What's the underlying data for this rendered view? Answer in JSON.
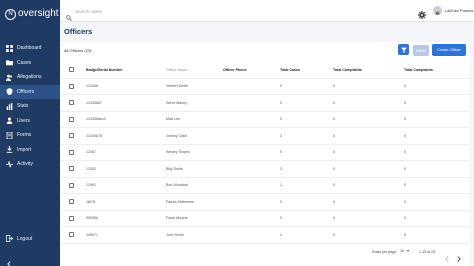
{
  "app": {
    "logo_text": "oversight",
    "logo_sub": "· · · · ·",
    "logo_icon": "N"
  },
  "sidebar": {
    "items": [
      {
        "label": "Dashboard",
        "icon": "grid-icon"
      },
      {
        "label": "Cases",
        "icon": "folder-icon"
      },
      {
        "label": "Allegations",
        "icon": "people-icon"
      },
      {
        "label": "Officers",
        "icon": "badge-icon",
        "active": true
      },
      {
        "label": "Stats",
        "icon": "bar-chart-icon"
      },
      {
        "label": "Users",
        "icon": "users-icon"
      },
      {
        "label": "Forms",
        "icon": "forms-icon"
      },
      {
        "label": "Import",
        "icon": "import-icon"
      },
      {
        "label": "Activity",
        "icon": "activity-icon"
      }
    ],
    "logout_label": "Logout"
  },
  "topbar": {
    "search_placeholder": "Search cases",
    "user_name": "LaDuke Powers"
  },
  "page": {
    "title": "Officers",
    "all_count": "All Officers (23)"
  },
  "actions": {
    "delete_label": "Delete",
    "create_label": "Create Officer"
  },
  "table": {
    "columns": [
      "Badge/Serial Number",
      "Officer Name",
      "Officer Phone",
      "Total Cases",
      "Total Complaints",
      "Total Complaints"
    ],
    "rows": [
      [
        "123456",
        "Jameer Smith",
        "",
        "0",
        "0",
        "0"
      ],
      [
        "12345667",
        "Steve Macey",
        "",
        "0",
        "0",
        "0"
      ],
      [
        "123456abc2",
        "Matt Lee",
        "",
        "0",
        "0",
        "0"
      ],
      [
        "12345678",
        "Johnny Cash",
        "",
        "3",
        "0",
        "0"
      ],
      [
        "12467",
        "Wesley Snipes",
        "",
        "0",
        "0",
        "0"
      ],
      [
        "12392",
        "Billy Smith",
        "",
        "3",
        "0",
        "0"
      ],
      [
        "12961",
        "Bob Woodard",
        "",
        "1",
        "0",
        "0"
      ],
      [
        "1f678",
        "Patrick Mahomes",
        "",
        "0",
        "0",
        "0"
      ],
      [
        "999356",
        "Frank Abrahe",
        "",
        "0",
        "0",
        "0"
      ],
      [
        "345671",
        "John Smith",
        "",
        "4",
        "0",
        "0"
      ]
    ]
  },
  "footer": {
    "rows_per_page_label": "Rows per page:",
    "rows_per_page_value": "10",
    "range_text": "1-10 of 23"
  },
  "colors": {
    "sidebar": "#1f3b63",
    "sidebar_active": "#2c5287",
    "primary": "#2f73d9",
    "disabled": "#b6c8e6"
  }
}
